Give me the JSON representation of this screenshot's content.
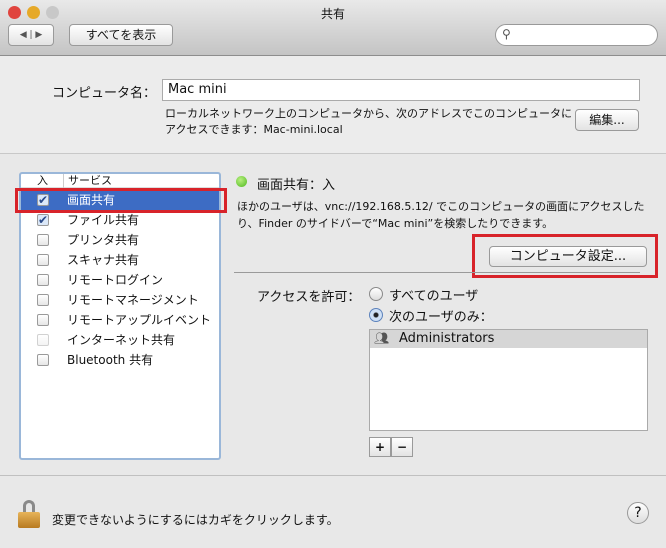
{
  "window": {
    "title": "共有",
    "show_all": "すべてを表示",
    "search_placeholder": ""
  },
  "computer_name": {
    "label": "コンピュータ名：",
    "value": "Mac mini",
    "desc1": "ローカルネットワーク上のコンピュータから、次のアドレスでこのコンピュータに",
    "desc2": "アクセスできます：Mac-mini.local",
    "edit": "編集..."
  },
  "services": {
    "col_on": "入",
    "col_service": "サービス",
    "items": [
      {
        "label": "画面共有",
        "checked": true,
        "selected": true
      },
      {
        "label": "ファイル共有",
        "checked": true
      },
      {
        "label": "プリンタ共有",
        "checked": false
      },
      {
        "label": "スキャナ共有",
        "checked": false
      },
      {
        "label": "リモートログイン",
        "checked": false
      },
      {
        "label": "リモートマネージメント",
        "checked": false
      },
      {
        "label": "リモートアップルイベント",
        "checked": false
      },
      {
        "label": "インターネット共有",
        "checked": false,
        "disabled": true
      },
      {
        "label": "Bluetooth 共有",
        "checked": false
      }
    ]
  },
  "detail": {
    "status": "画面共有：入",
    "desc1": "ほかのユーザは、vnc://192.168.5.12/ でこのコンピュータの画面にアクセスした",
    "desc2": "り、Finder のサイドバーで“Mac mini”を検索したりできます。",
    "computer_settings": "コンピュータ設定...",
    "access_label": "アクセスを許可：",
    "opt_all": "すべてのユーザ",
    "opt_only": "次のユーザのみ：",
    "users": [
      "Administrators"
    ],
    "add": "+",
    "remove": "−"
  },
  "footer": {
    "lock_text": "変更できないようにするにはカギをクリックします。",
    "help": "?"
  },
  "colors": {
    "highlight": "#d8232a",
    "selection": "#3d6cc4",
    "status": "#4fb820"
  }
}
